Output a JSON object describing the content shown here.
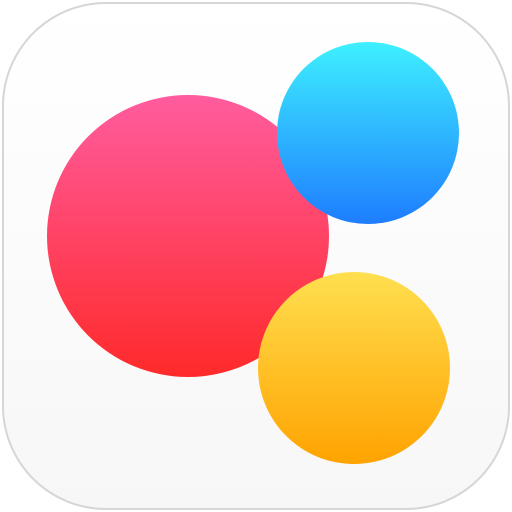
{
  "icon": {
    "label": "",
    "colors": {
      "background": "#ffffff",
      "border": "#d6d6da",
      "red_top": "#ff5c9f",
      "red_bottom": "#ff2a2a",
      "blue_top": "#3ef0ff",
      "blue_bottom": "#1e7dff",
      "yellow_top": "#ffdf50",
      "yellow_bottom": "#ffa300"
    }
  }
}
